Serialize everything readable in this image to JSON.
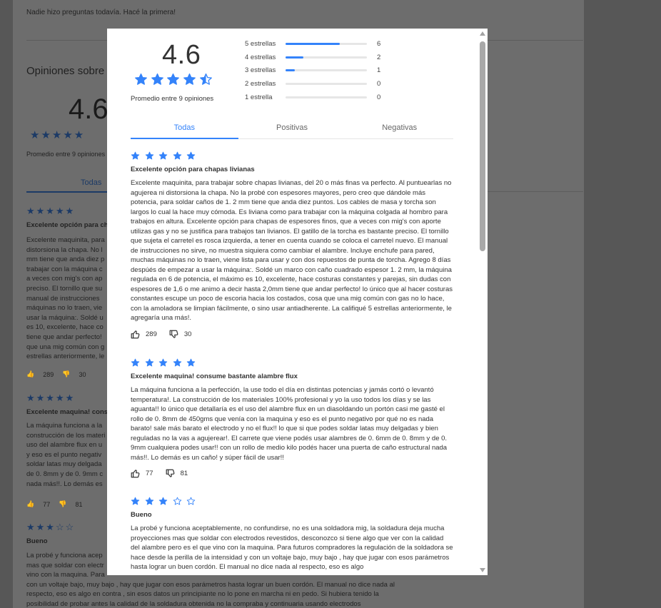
{
  "background": {
    "questions_empty": "Nadie hizo preguntas todavía. Hacé la primera!",
    "heading": "Opiniones sobre",
    "rating": "4.6",
    "avg_text": "Promedio entre 9 opiniones",
    "tab_all": "Todas",
    "r1_title": "Excelente opción para ch",
    "r1_lines": [
      "Excelente maquinita, para",
      "distorsiona la chapa. No l",
      "mm tiene que anda diez p",
      "trabajar con la máquina c",
      "a veces con mig's con ap",
      "preciso. El tornillo que su",
      "manual de instrucciones",
      "máquinas no lo traen, vie",
      "usar la máquina:. Soldé u",
      "es 10, excelente, hace co",
      "tiene que andar perfecto!",
      "que una mig común con g",
      "estrellas anteriormente, le"
    ],
    "r1_up": "289",
    "r1_down": "30",
    "r2_title": "Excelente maquina! cons",
    "r2_lines": [
      "La máquina funciona a la",
      "construcción de los materi",
      "uso del alambre flux en u",
      "y eso es el punto negativ",
      "soldar latas muy delgada",
      "de 0. 8mm y de 0. 9mm c",
      "nada más!!. Lo demás es"
    ],
    "r2_up": "77",
    "r2_down": "81",
    "r3_title": "Bueno",
    "r3_lines": [
      "La probé y funciona acep",
      "mas que soldar con electr",
      "vino con la maquina. Para",
      "con un voltaje bajo, muy bajo , hay que jugar con esos parámetros hasta lograr un buen cordón. El manual no dice nada al",
      "respecto, eso es algo en contra , sin esos datos un principiante no lo pone en marcha ni en pedo. Si hubiera tenido la",
      "posibilidad de probar antes la calidad de la soldadura obtenida no la compraba y continuaria usando electrodos"
    ]
  },
  "summary": {
    "rating": "4.6",
    "stars": 4.5,
    "avg_text": "Promedio entre 9 opiniones",
    "histogram": [
      {
        "label": "5 estrellas",
        "count": "6",
        "fraction": 0.667
      },
      {
        "label": "4 estrellas",
        "count": "2",
        "fraction": 0.222
      },
      {
        "label": "3 estrellas",
        "count": "1",
        "fraction": 0.111
      },
      {
        "label": "2 estrellas",
        "count": "0",
        "fraction": 0
      },
      {
        "label": "1 estrella",
        "count": "0",
        "fraction": 0
      }
    ]
  },
  "tabs": [
    "Todas",
    "Positivas",
    "Negativas"
  ],
  "reviews": [
    {
      "stars": 5,
      "title": "Excelente opción para chapas livianas",
      "body": "Excelente maquinita, para trabajar sobre chapas livianas, del 20 o más finas va perfecto. Al puntuearlas no agujerea ni distorsiona la chapa. No la probé con espesores mayores, pero creo que dándole más potencia, para soldar caños de 1. 2 mm tiene que anda diez puntos. Los cables de masa y torcha son largos lo cual la hace muy cómoda. Es liviana como para trabajar con la máquina colgada al hombro para trabajos en altura. Excelente opción para chapas de espesores finos, que a veces con mig's con aporte utilizas gas y no se justifica para trabajos tan livianos. El gatillo de la torcha es bastante preciso. El tornillo que sujeta el carretel es rosca izquierda, a tener en cuenta cuando se coloca el carretel nuevo. El manual de instrucciones no sirve, no muestra siquiera como cambiar el alambre. Incluye enchufe para pared, muchas máquinas no lo traen, viene lista para usar y con dos repuestos de punta de torcha. Agrego 8 días despúés de empezar a usar la máquina:. Soldé un marco con caño cuadrado espesor 1. 2 mm, la máquina regulada en 6 de potencia, el máximo es 10, excelente, hace costuras constantes y parejas, sin dudas con espesores de 1,6 o me animo a decir hasta 2,0mm tiene que andar perfecto! lo único que al hacer costuras constantes escupe un poco de escoria hacia los costados, cosa que una mig común con gas no lo hace, con la amoladora se limpian fácilmente, o sino usar antiadherente. La califiqué 5 estrellas anteriormente, le agregaría una más!.",
      "up": "289",
      "down": "30"
    },
    {
      "stars": 5,
      "title": "Excelente maquina! consume bastante alambre flux",
      "body": "La máquina funciona a la perfección, la use todo el día en distintas potencias y jamás cortó o levantó temperatura!. La construcción de los materiales 100% profesional y yo la uso todos los días y se las aguanta!! lo único que detallaría es el uso del alambre flux en un diasoldando un portón casi me gasté el rollo de 0. 8mm de 450gms que venía con la maquina y eso es el punto negativo por qué no es nada barato! sale más barato el electrodo y no el flux!! lo que si que podes soldar latas muy delgadas y bien reguladas no la vas a agujerear!. El carrete que viene podés usar alambres de 0. 6mm de 0. 8mm y de 0. 9mm cualquiera podes usar!! con un rollo de medio kilo podés hacer una puerta de caño estructural nada más!!. Lo demás es un caño! y súper fácil de usar!!",
      "up": "77",
      "down": "81"
    },
    {
      "stars": 3,
      "title": "Bueno",
      "body": "La probé y funciona aceptablemente, no confundirse, no es una soldadora mig, la soldadura deja mucha proyecciones mas que soldar con electrodos revestidos, desconozco si tiene algo que ver con la calidad del alambre pero es el que vino con la maquina. Para futuros compradores la regulación de la soldadora se hace desde la perilla de la intensidad y con un voltaje bajo, muy bajo , hay que jugar con esos parámetros hasta lograr un buen cordón. El manual no dice nada al respecto, eso es algo"
    }
  ],
  "colors": {
    "accent": "#3483fa",
    "text": "#333333",
    "overlay": "#5a5a5a"
  }
}
